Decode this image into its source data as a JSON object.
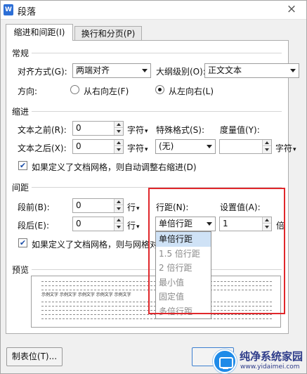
{
  "window": {
    "title": "段落",
    "app_icon": "W",
    "close_symbol": "×"
  },
  "tabs": [
    {
      "label": "缩进和间距(I)",
      "active": true
    },
    {
      "label": "换行和分页(P)",
      "active": false
    }
  ],
  "general": {
    "heading": "常规",
    "alignment_label": "对齐方式(G):",
    "alignment_value": "两端对齐",
    "outline_label": "大纲级别(O):",
    "outline_value": "正文文本",
    "direction_label": "方向:",
    "rtl_label": "从右向左(F)",
    "ltr_label": "从左向右(L)",
    "selected_direction": "ltr"
  },
  "indent": {
    "heading": "缩进",
    "before_label": "文本之前(R):",
    "before_value": "0",
    "before_unit": "字符",
    "after_label": "文本之后(X):",
    "after_value": "0",
    "after_unit": "字符",
    "special_label": "特殊格式(S):",
    "special_value": "(无)",
    "measure_label": "度量值(Y):",
    "measure_value": "",
    "measure_unit": "字符",
    "grid_checkbox_label": "如果定义了文档网格，则自动调整右缩进(D)",
    "grid_checked": true
  },
  "spacing": {
    "heading": "间距",
    "before_label": "段前(B):",
    "before_value": "0",
    "before_unit": "行",
    "after_label": "段后(E):",
    "after_value": "0",
    "after_unit": "行",
    "line_spacing_label": "行距(N):",
    "line_spacing_value": "单倍行距",
    "setting_label": "设置值(A):",
    "setting_value": "1",
    "setting_unit": "倍",
    "grid_checkbox_label": "如果定义了文档网格，则与网格对",
    "grid_checked": true
  },
  "line_spacing_options": [
    "单倍行距",
    "1.5 倍行距",
    "2 倍行距",
    "最小值",
    "固定值",
    "多倍行距"
  ],
  "preview": {
    "heading": "预览",
    "sample_text": "示例文字 示例文字 示例文字 示例文字 示例文字",
    "prev_text": "前一段落前一段落前一段落前一段落前一段落前一段落前一段落前一段落前一段落",
    "next_text": "下一段落下一段落下一段落下一段落下一段落下一段落下一段落下一段落下一段落"
  },
  "footer": {
    "tabs_button": "制表位(T)..."
  },
  "watermark": {
    "title": "纯净系统家园",
    "url": "www.yidaimei.com"
  },
  "colors": {
    "highlight": "#cfe2f6",
    "annotation_box": "#e0272b",
    "watermark": "#2e3c8a"
  }
}
